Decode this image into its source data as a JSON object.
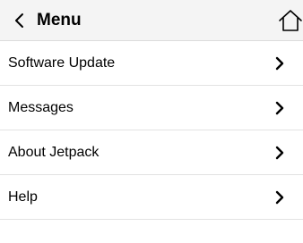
{
  "header": {
    "title": "Menu",
    "back_icon": "chevron-left-icon",
    "home_icon": "home-icon"
  },
  "menu": {
    "items": [
      {
        "label": "Software Update",
        "icon": "chevron-right-icon"
      },
      {
        "label": "Messages",
        "icon": "chevron-right-icon"
      },
      {
        "label": "About Jetpack",
        "icon": "chevron-right-icon"
      },
      {
        "label": "Help",
        "icon": "chevron-right-icon"
      }
    ]
  },
  "colors": {
    "header_bg": "#f4f4f4",
    "divider": "#e2e2e2",
    "text": "#000000"
  }
}
